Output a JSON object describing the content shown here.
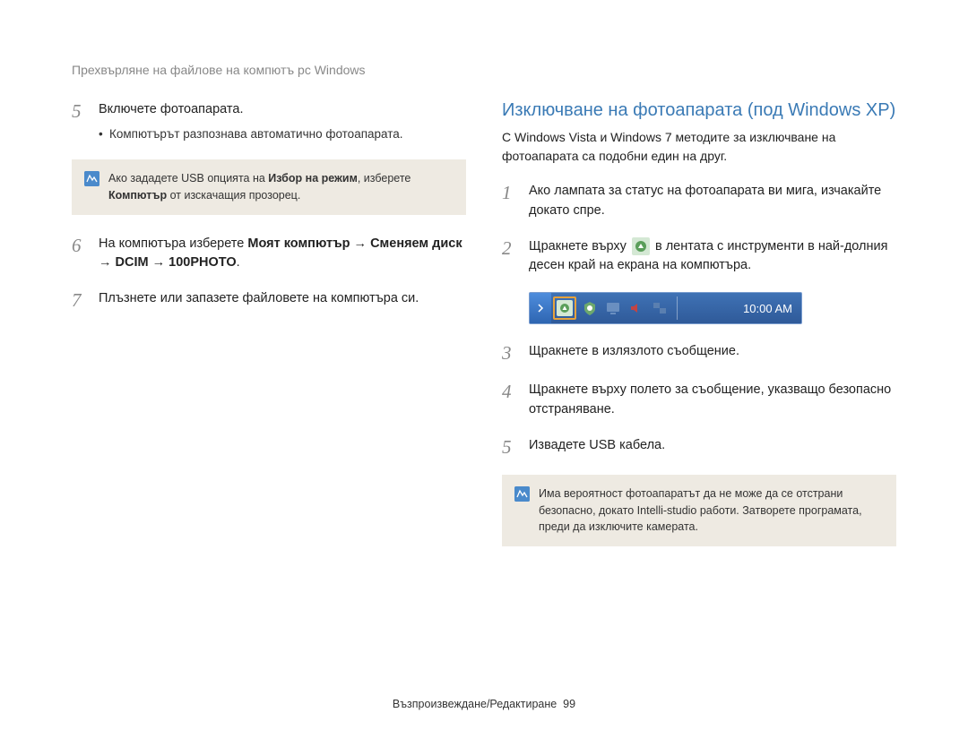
{
  "header": "Прехвърляне на файлове на компютъ pc Windows",
  "left": {
    "steps": [
      {
        "num": "5",
        "text": "Включете фотоапарата.",
        "bullet": "Компютърът разпознава автоматично фотоапарата."
      },
      {
        "num": "6",
        "prefix": "На компютъра изберете ",
        "bold1": "Моят компютър",
        "arrow1": " → ",
        "bold2": "Сменяем диск",
        "arrow2": " → ",
        "bold3": "DCIM",
        "arrow3": " → ",
        "bold4": "100PHOTO",
        "suffix": "."
      },
      {
        "num": "7",
        "text": "Плъзнете или запазете файловете на компютъра си."
      }
    ],
    "note": {
      "pre": "Ако зададете USB опцията на ",
      "bold1": "Избор на режим",
      "mid": ", изберете ",
      "bold2": "Компютър",
      "post": " от изскачащия прозорец."
    }
  },
  "right": {
    "title": "Изключване на фотоапарата (под Windows XP)",
    "intro": "С Windows Vista и Windows 7 методите за изключване на фотоапарата са подобни един на друг.",
    "steps": [
      {
        "num": "1",
        "text": "Ако лампата за статус на фотоапарата ви мига, изчакайте докато спре."
      },
      {
        "num": "2",
        "pre": "Щракнете върху ",
        "post": " в лентата с инструменти в най-долния десен край на екрана на компютъра."
      },
      {
        "num": "3",
        "text": "Щракнете в излязлото съобщение."
      },
      {
        "num": "4",
        "text": "Щракнете върху полето за съобщение, указващо безопасно отстраняване."
      },
      {
        "num": "5",
        "text": "Извадете USB кабела."
      }
    ],
    "note": "Има вероятност фотоапаратът да не може да се отстрани безопасно, докато Intelli-studio работи. Затворете програмата, преди да изключите камерата.",
    "taskbar_time": "10:00 AM"
  },
  "footer": {
    "text": "Възпроизвеждане/Редактиране",
    "page": "99"
  }
}
